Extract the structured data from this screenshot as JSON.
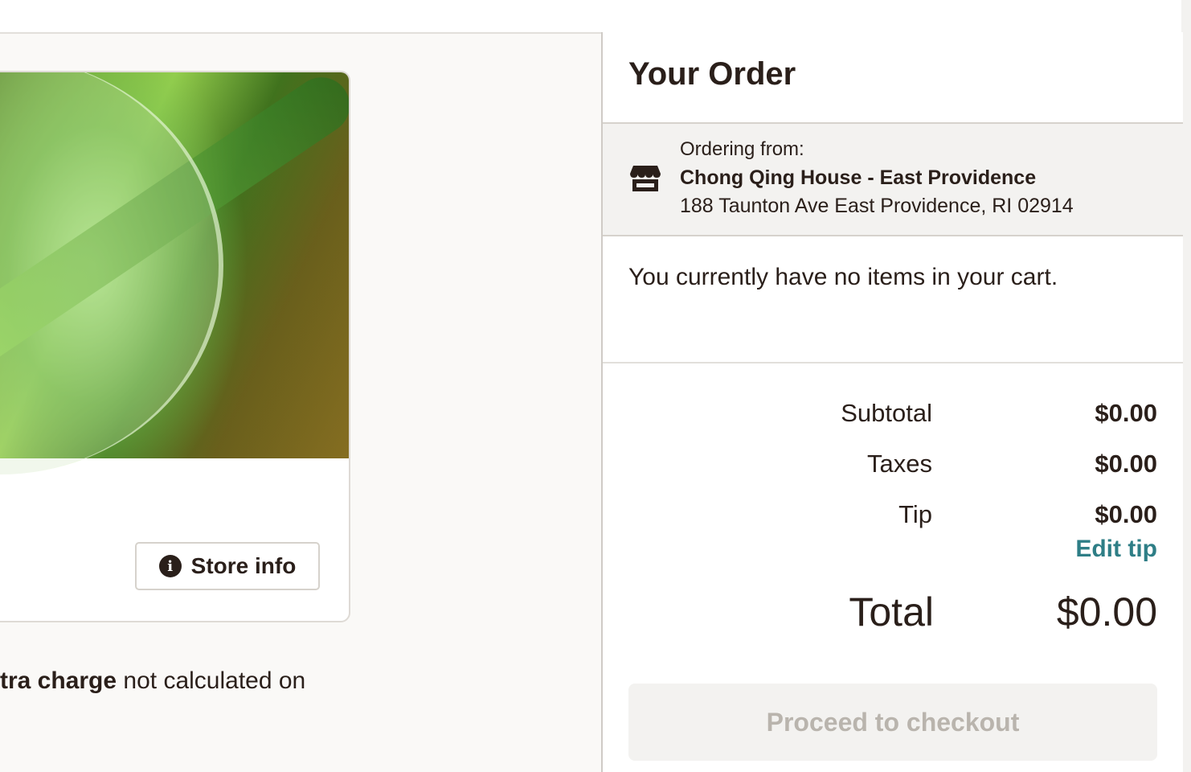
{
  "left": {
    "store_info_label": "Store info",
    "charge_note_bold": "tra charge",
    "charge_note_rest": " not calculated on"
  },
  "order": {
    "title": "Your Order",
    "ordering_from_label": "Ordering from:",
    "store_name": "Chong Qing House - East Providence",
    "store_address": "188 Taunton Ave East Providence, RI 02914",
    "empty_message": "You currently have no items in your cart.",
    "subtotal_label": "Subtotal",
    "subtotal_value": "$0.00",
    "taxes_label": "Taxes",
    "taxes_value": "$0.00",
    "tip_label": "Tip",
    "tip_value": "$0.00",
    "edit_tip_label": "Edit tip",
    "total_label": "Total",
    "total_value": "$0.00",
    "checkout_label": "Proceed to checkout"
  },
  "icons": {
    "info": "info-icon",
    "store": "store-icon"
  },
  "colors": {
    "link": "#2e7e86",
    "text": "#2a1f1a",
    "disabled_text": "#b9b4ad"
  }
}
